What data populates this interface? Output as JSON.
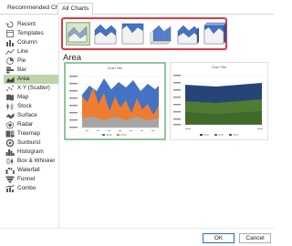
{
  "tabs": [
    {
      "label": "Recommended Charts"
    },
    {
      "label": "All Charts"
    }
  ],
  "sidebar": {
    "items": [
      {
        "label": "Recent",
        "icon": "recent-icon"
      },
      {
        "label": "Templates",
        "icon": "templates-icon"
      },
      {
        "label": "Column",
        "icon": "column-chart-icon"
      },
      {
        "label": "Line",
        "icon": "line-chart-icon"
      },
      {
        "label": "Pie",
        "icon": "pie-chart-icon"
      },
      {
        "label": "Bar",
        "icon": "bar-chart-icon"
      },
      {
        "label": "Area",
        "icon": "area-chart-icon",
        "selected": true
      },
      {
        "label": "X Y (Scatter)",
        "icon": "scatter-chart-icon"
      },
      {
        "label": "Map",
        "icon": "map-chart-icon"
      },
      {
        "label": "Stock",
        "icon": "stock-chart-icon"
      },
      {
        "label": "Surface",
        "icon": "surface-chart-icon"
      },
      {
        "label": "Radar",
        "icon": "radar-chart-icon"
      },
      {
        "label": "Treemap",
        "icon": "treemap-chart-icon"
      },
      {
        "label": "Sunburst",
        "icon": "sunburst-chart-icon"
      },
      {
        "label": "Histogram",
        "icon": "histogram-chart-icon"
      },
      {
        "label": "Box & Whisker",
        "icon": "box-whisker-chart-icon"
      },
      {
        "label": "Waterfall",
        "icon": "waterfall-chart-icon"
      },
      {
        "label": "Funnel",
        "icon": "funnel-chart-icon"
      },
      {
        "label": "Combo",
        "icon": "combo-chart-icon"
      }
    ]
  },
  "subtypes": [
    {
      "icon": "area-icon",
      "selected": true
    },
    {
      "icon": "stacked-area-icon"
    },
    {
      "icon": "100-percent-stacked-area-icon"
    },
    {
      "icon": "3d-area-icon"
    },
    {
      "icon": "3d-stacked-area-icon"
    },
    {
      "icon": "3d-100-percent-stacked-area-icon"
    }
  ],
  "main": {
    "section_title": "Area",
    "previews": [
      {
        "title": "Chart Title"
      },
      {
        "title": "Chart Title"
      }
    ]
  },
  "buttons": {
    "ok": "OK",
    "cancel": "Cancel"
  },
  "colors": {
    "selection": "#bcd4a8",
    "highlight_border": "#e0383f",
    "series_blue": "#4472c4",
    "series_orange": "#ed7d31",
    "series_gray": "#a5a5a5",
    "series_green": "#70ad47"
  }
}
